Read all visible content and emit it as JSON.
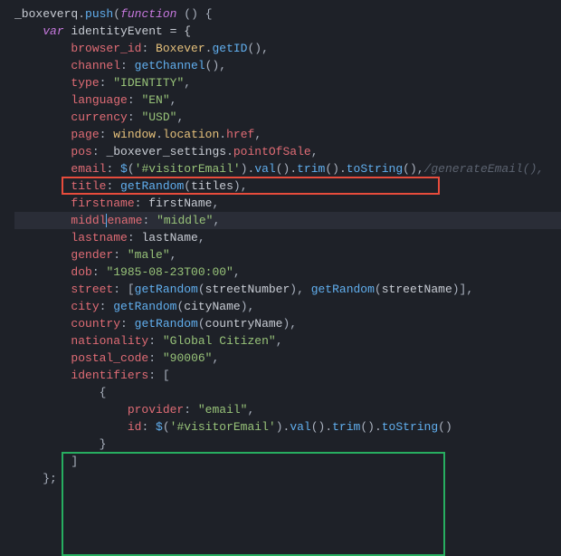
{
  "code": {
    "l1": {
      "a": "_boxeverq",
      "b": ".",
      "c": "push",
      "d": "(",
      "e": "function",
      "f": " () {"
    },
    "l2": {
      "a": "var",
      "b": " identityEvent = {"
    },
    "l3": {
      "k": "browser_id",
      "c": ": ",
      "o": "Boxever",
      "d": ".",
      "f": "getID",
      "p": "(),"
    },
    "l4": {
      "k": "channel",
      "c": ": ",
      "f": "getChannel",
      "p": "(),"
    },
    "l5": {
      "k": "type",
      "c": ": ",
      "s": "\"IDENTITY\"",
      "p": ","
    },
    "l6": {
      "k": "language",
      "c": ": ",
      "s": "\"EN\"",
      "p": ","
    },
    "l7": {
      "k": "currency",
      "c": ": ",
      "s": "\"USD\"",
      "p": ","
    },
    "l8": {
      "k": "page",
      "c": ": ",
      "o1": "window",
      "d1": ".",
      "o2": "location",
      "d2": ".",
      "p1": "href",
      "p2": ","
    },
    "l9": {
      "k": "pos",
      "c": ": ",
      "o": "_boxever_settings",
      "d": ".",
      "p1": "pointOfSale",
      "p2": ","
    },
    "l10": {
      "k": "email",
      "c": ": ",
      "f1": "$",
      "p1": "(",
      "s": "'#visitorEmail'",
      "p2": ").",
      "f2": "val",
      "p3": "().",
      "f3": "trim",
      "p4": "().",
      "f4": "toString",
      "p5": "(),",
      "cm": "/generateEmail(),"
    },
    "l11": {
      "k": "title",
      "c": ": ",
      "f": "getRandom",
      "p1": "(",
      "a": "titles",
      "p2": "),"
    },
    "l12": {
      "k": "firstname",
      "c": ": ",
      "a": "firstName",
      "p": ","
    },
    "l13": {
      "k1": "middl",
      "k2": "ename",
      "c": ": ",
      "s": "\"middle\"",
      "p": ","
    },
    "l14": {
      "k": "lastname",
      "c": ": ",
      "a": "lastName",
      "p": ","
    },
    "l15": {
      "k": "gender",
      "c": ": ",
      "s": "\"male\"",
      "p": ","
    },
    "l16": {
      "k": "dob",
      "c": ": ",
      "s": "\"1985-08-23T00:00\"",
      "p": ","
    },
    "l17": {
      "k": "street",
      "c": ": [",
      "f1": "getRandom",
      "p1": "(",
      "a1": "streetNumber",
      "p2": "), ",
      "f2": "getRandom",
      "p3": "(",
      "a2": "streetName",
      "p4": ")],"
    },
    "l18": {
      "k": "city",
      "c": ": ",
      "f": "getRandom",
      "p1": "(",
      "a": "cityName",
      "p2": "),"
    },
    "l19": {
      "k": "country",
      "c": ": ",
      "f": "getRandom",
      "p1": "(",
      "a": "countryName",
      "p2": "),"
    },
    "l20": {
      "k": "nationality",
      "c": ": ",
      "s": "\"Global Citizen\"",
      "p": ","
    },
    "l21": {
      "k": "postal_code",
      "c": ": ",
      "s": "\"90006\"",
      "p": ","
    },
    "l22": {
      "k": "identifiers",
      "c": ": ["
    },
    "l23": {
      "p": "{"
    },
    "l24": {
      "k": "provider",
      "c": ": ",
      "s": "\"email\"",
      "p": ","
    },
    "l25": {
      "k": "id",
      "c": ": ",
      "f1": "$",
      "p1": "(",
      "s": "'#visitorEmail'",
      "p2": ").",
      "f2": "val",
      "p3": "().",
      "f3": "trim",
      "p4": "().",
      "f4": "toString",
      "p5": "()"
    },
    "l26": {
      "p": "}"
    },
    "l27": {
      "p": "]"
    },
    "l28": {
      "p": "};"
    }
  }
}
